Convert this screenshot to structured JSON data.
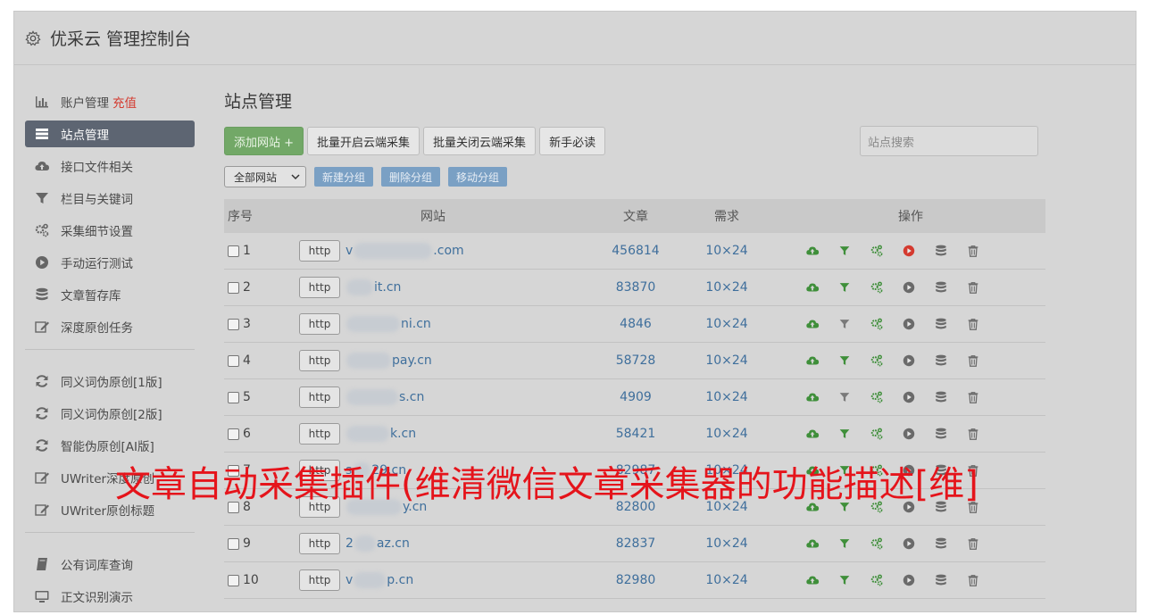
{
  "header": {
    "brand": "优采云 管理控制台"
  },
  "sidebar": {
    "group1": [
      {
        "icon": "bar-chart-icon",
        "label": "账户管理",
        "extra": "充值"
      },
      {
        "icon": "server-icon",
        "label": "站点管理",
        "active": true
      },
      {
        "icon": "cloud-upload-icon",
        "label": "接口文件相关"
      },
      {
        "icon": "filter-icon",
        "label": "栏目与关键词"
      },
      {
        "icon": "cogs-icon",
        "label": "采集细节设置"
      },
      {
        "icon": "play-circle-icon",
        "label": "手动运行测试"
      },
      {
        "icon": "database-icon",
        "label": "文章暂存库"
      },
      {
        "icon": "edit-icon",
        "label": "深度原创任务"
      }
    ],
    "group2": [
      {
        "icon": "refresh-icon",
        "label": "同义词伪原创[1版]"
      },
      {
        "icon": "refresh-icon",
        "label": "同义词伪原创[2版]"
      },
      {
        "icon": "refresh-icon",
        "label": "智能伪原创[AI版]"
      },
      {
        "icon": "edit-icon",
        "label": "UWriter深度原创"
      },
      {
        "icon": "edit-icon",
        "label": "UWriter原创标题"
      }
    ],
    "group3": [
      {
        "icon": "book-icon",
        "label": "公有词库查询"
      },
      {
        "icon": "monitor-icon",
        "label": "正文识别演示"
      }
    ]
  },
  "main": {
    "title": "站点管理",
    "buttons": {
      "add": "添加网站 +",
      "batch_open": "批量开启云端采集",
      "batch_close": "批量关闭云端采集",
      "guide": "新手必读"
    },
    "search_placeholder": "站点搜索",
    "filter_select": "全部网站",
    "group_buttons": {
      "new": "新建分组",
      "delete": "删除分组",
      "move": "移动分组"
    },
    "table": {
      "headers": {
        "idx": "序号",
        "site": "网站",
        "articles": "文章",
        "need": "需求",
        "ops": "操作"
      },
      "rows": [
        {
          "idx": "1",
          "proto": "http",
          "pre": "v",
          "suf": ".com",
          "articles": "456814",
          "need": "10×24",
          "filter_active": true,
          "play_active": true
        },
        {
          "idx": "2",
          "proto": "http",
          "pre": "",
          "suf": "it.cn",
          "articles": "83870",
          "need": "10×24",
          "filter_active": true,
          "play_active": false
        },
        {
          "idx": "3",
          "proto": "http",
          "pre": "",
          "suf": "ni.cn",
          "articles": "4846",
          "need": "10×24",
          "filter_active": false,
          "play_active": false
        },
        {
          "idx": "4",
          "proto": "http",
          "pre": "",
          "suf": "pay.cn",
          "articles": "58728",
          "need": "10×24",
          "filter_active": true,
          "play_active": false
        },
        {
          "idx": "5",
          "proto": "http",
          "pre": "",
          "suf": "s.cn",
          "articles": "4909",
          "need": "10×24",
          "filter_active": false,
          "play_active": false
        },
        {
          "idx": "6",
          "proto": "http",
          "pre": "",
          "suf": "k.cn",
          "articles": "58421",
          "need": "10×24",
          "filter_active": true,
          "play_active": false
        },
        {
          "idx": "7",
          "proto": "http",
          "pre": "s",
          "suf": "29.cn",
          "articles": "82987",
          "need": "10×24",
          "filter_active": true,
          "play_active": false
        },
        {
          "idx": "8",
          "proto": "http",
          "pre": "",
          "suf": "y.cn",
          "articles": "82800",
          "need": "10×24",
          "filter_active": true,
          "play_active": false
        },
        {
          "idx": "9",
          "proto": "http",
          "pre": "2",
          "suf": "az.cn",
          "articles": "82837",
          "need": "10×24",
          "filter_active": true,
          "play_active": false
        },
        {
          "idx": "10",
          "proto": "http",
          "pre": "v",
          "suf": "p.cn",
          "articles": "82980",
          "need": "10×24",
          "filter_active": true,
          "play_active": false
        }
      ]
    }
  },
  "overlay": {
    "text": "文章自动采集插件(维清微信文章采集器的功能描述[维]"
  },
  "colors": {
    "active_nav": "#5d6572",
    "add_button": "#72a867",
    "group_button": "#7aa0c4",
    "link_blue": "#3f6f9c",
    "upload_green": "#3f8f3a",
    "play_red": "#d43a2f",
    "overlay_red": "#e5141b"
  }
}
